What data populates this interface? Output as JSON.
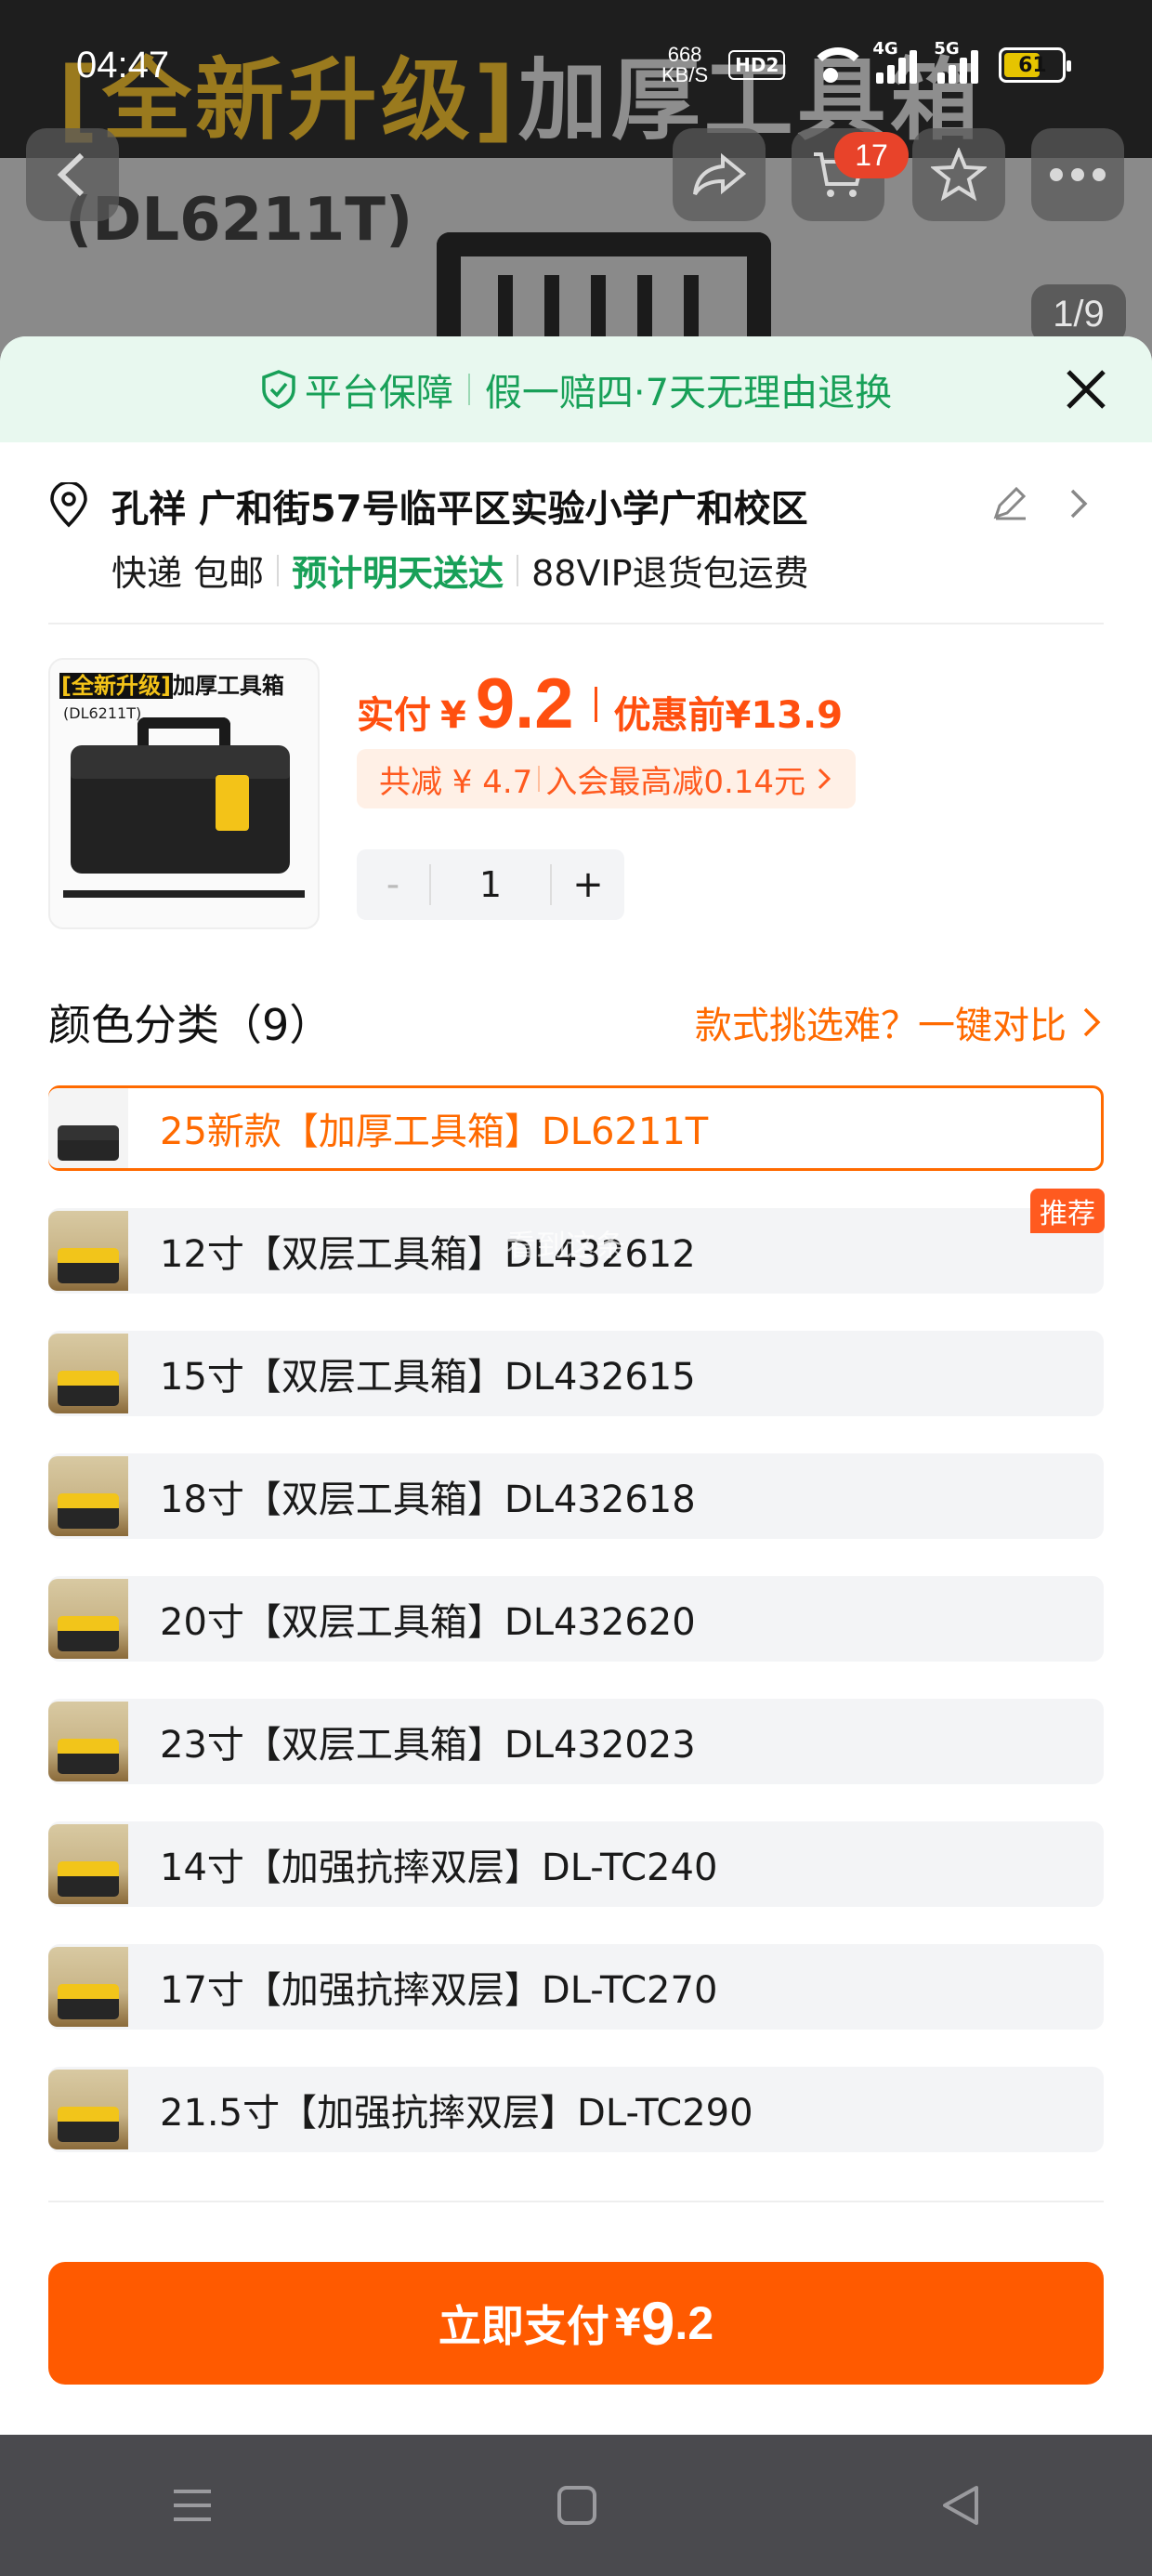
{
  "status_bar": {
    "time": "04:47",
    "net_speed_value": "668",
    "net_speed_unit": "KB/S",
    "hd_label": "HD2",
    "signal_1": "4G",
    "signal_2": "5G",
    "battery": "61"
  },
  "background": {
    "banner_bracket": "[全新升级]",
    "banner_title": "加厚工具箱",
    "model": "(DL6211T)",
    "cart_count": "17",
    "image_index": "1/9"
  },
  "guarantee": {
    "platform": "平台保障",
    "policy": "假一赔四·7天无理由退换"
  },
  "address": {
    "text": "孔祥 广和街57号临平区实验小学广和校区"
  },
  "shipping": {
    "method": "快递 包邮",
    "delivery": "预计明天送达",
    "return": "88VIP退货包运费"
  },
  "product_thumb": {
    "tag": "[全新升级]",
    "title": "加厚工具箱",
    "model": "(DL6211T)"
  },
  "price": {
    "paid_label": "实付",
    "currency": "¥",
    "amount": "9.2",
    "before_label": "优惠前",
    "before_amount": "¥13.9",
    "discount_total": "共减 ¥ 4.7",
    "member_note": "入会最高减0.14元"
  },
  "quantity": {
    "minus": "-",
    "value": "1",
    "plus": "+"
  },
  "variants": {
    "title": "颜色分类（9）",
    "compare_link": "款式挑选难？一键对比",
    "recommend_tag": "推荐",
    "watermark": "看到这条",
    "items": [
      {
        "label": "25新款【加厚工具箱】DL6211T",
        "selected": true
      },
      {
        "label": "12寸【双层工具箱】DL432612",
        "selected": false
      },
      {
        "label": "15寸【双层工具箱】DL432615",
        "selected": false
      },
      {
        "label": "18寸【双层工具箱】DL432618",
        "selected": false
      },
      {
        "label": "20寸【双层工具箱】DL432620",
        "selected": false
      },
      {
        "label": "23寸【双层工具箱】DL432023",
        "selected": false
      },
      {
        "label": "14寸【加强抗摔双层】DL-TC240",
        "selected": false
      },
      {
        "label": "17寸【加强抗摔双层】DL-TC270",
        "selected": false
      },
      {
        "label": "21.5寸【加强抗摔双层】DL-TC290",
        "selected": false
      }
    ]
  },
  "pay_button": {
    "label": "立即支付",
    "currency": "¥",
    "amount_int": "9",
    "amount_dec": ".2"
  },
  "colors": {
    "accent": "#ff5a00",
    "green": "#18a058",
    "sheet_bg": "#ffffff"
  }
}
